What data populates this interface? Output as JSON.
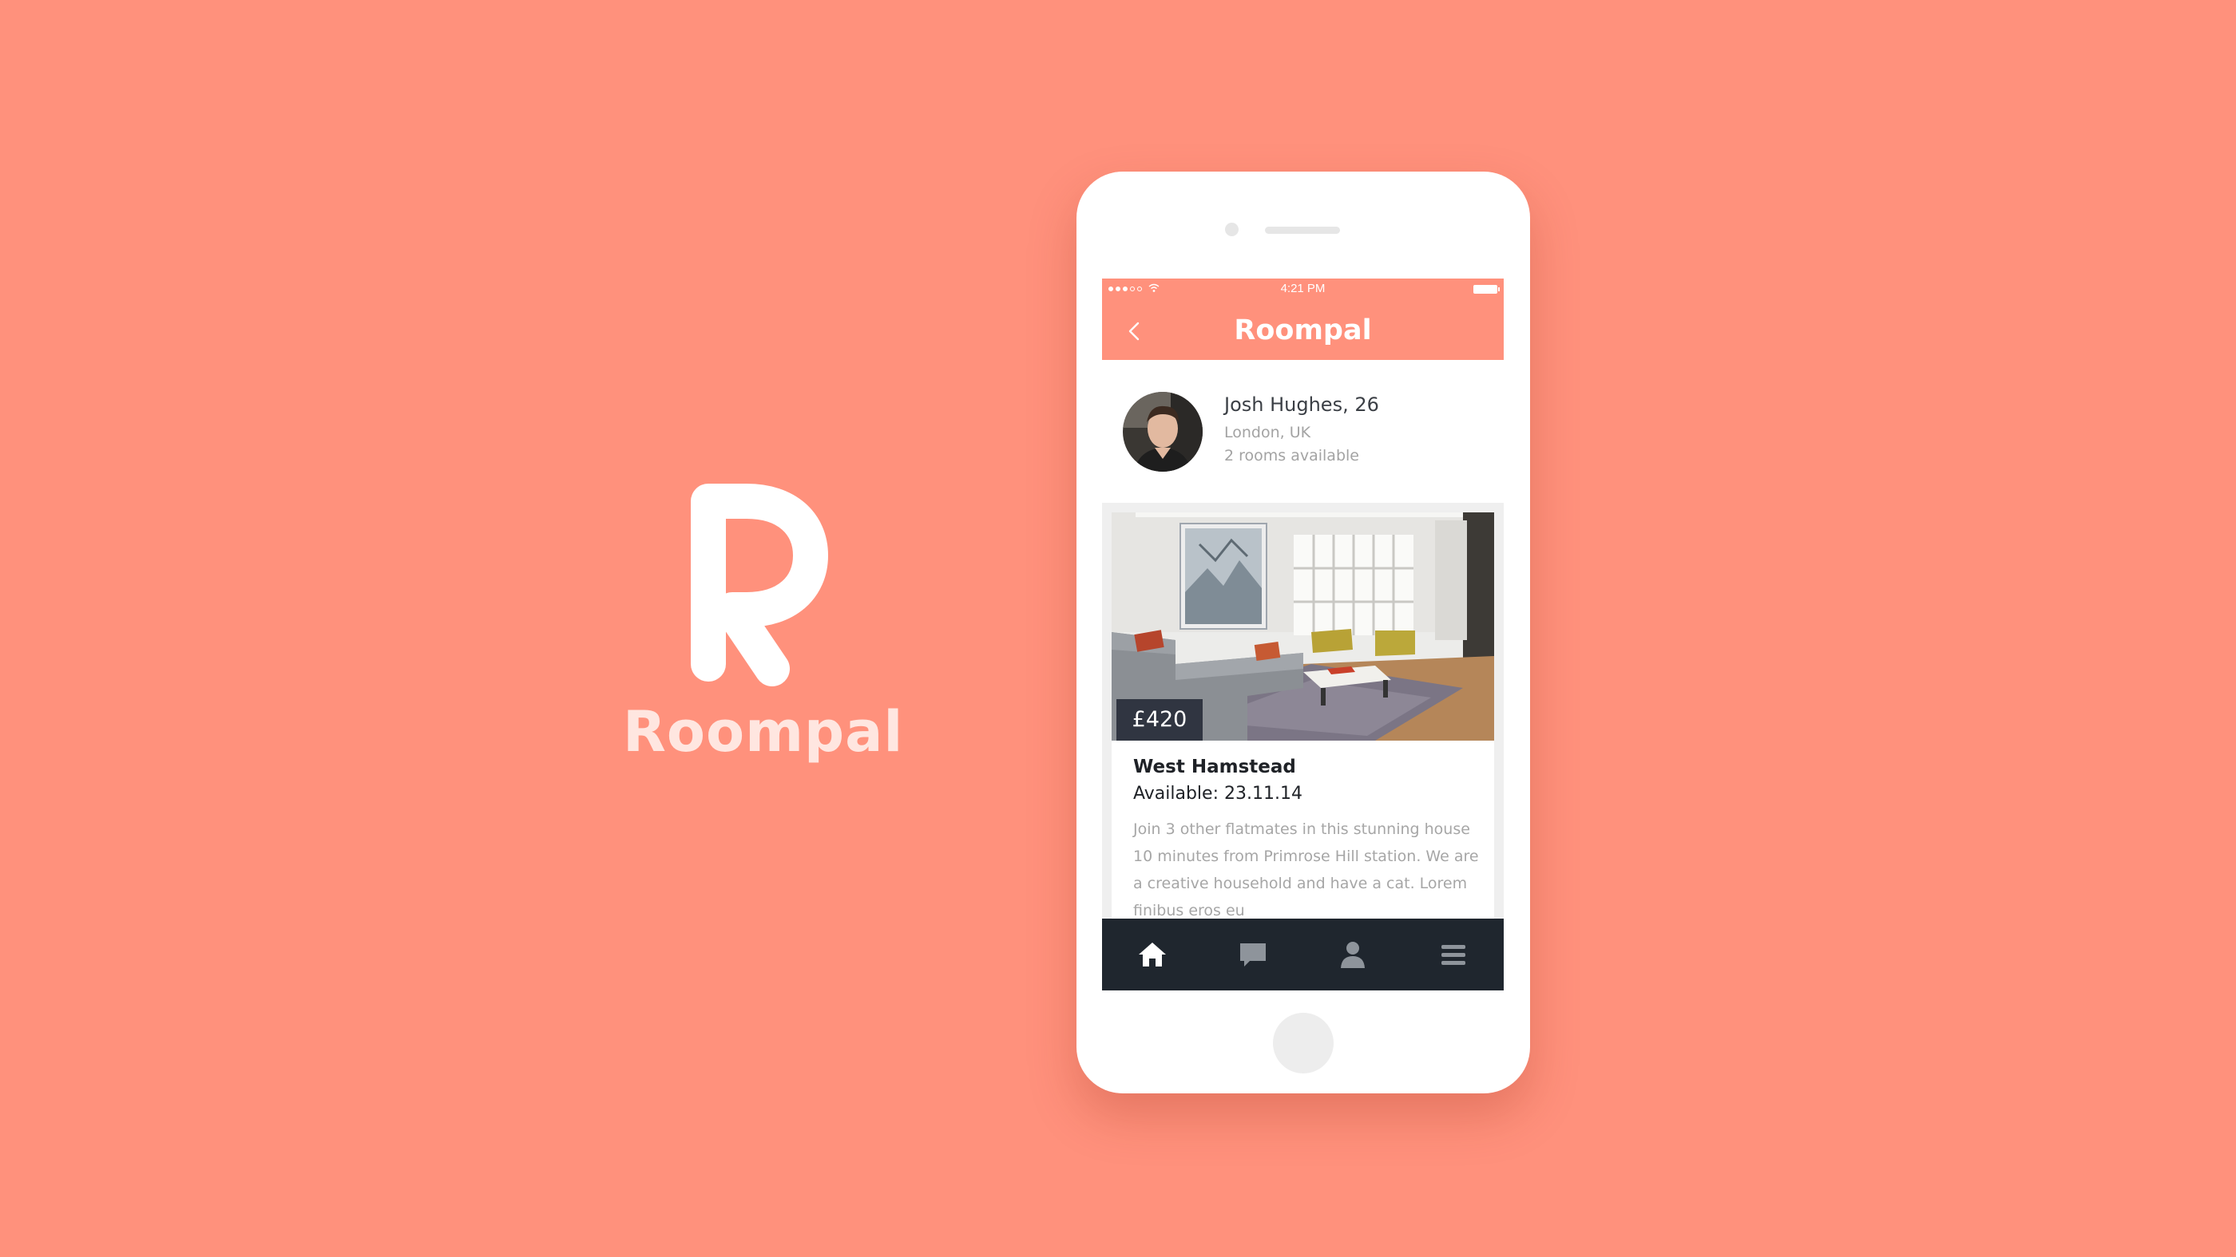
{
  "brand": {
    "name": "Roompal",
    "logo_letter_icon": "roompal-r-logo"
  },
  "status_bar": {
    "signal_dots": 5,
    "signal_strength": 3,
    "wifi_icon": "wifi-icon",
    "time": "4:21 PM",
    "battery_icon": "battery-icon"
  },
  "nav": {
    "back_icon": "chevron-left-icon",
    "title": "Roompal"
  },
  "profile": {
    "name": "Josh Hughes, 26",
    "location": "London, UK",
    "rooms": "2 rooms available",
    "avatar_icon": "avatar"
  },
  "listing": {
    "price": "£420",
    "area": "West Hamstead",
    "available": "Available: 23.11.14",
    "description": "Join 3 other flatmates in this stunning house 10 minutes from Primrose Hill station. We are a creative household and have a cat. Lorem finibus eros eu"
  },
  "tab_bar": {
    "items": [
      {
        "name": "home",
        "icon": "home-icon",
        "active": true
      },
      {
        "name": "messages",
        "icon": "chat-icon",
        "active": false
      },
      {
        "name": "profile",
        "icon": "user-icon",
        "active": false
      },
      {
        "name": "menu",
        "icon": "menu-icon",
        "active": false
      }
    ]
  },
  "colors": {
    "background": "#FF917C",
    "tab_bar": "#1F262E",
    "price_badge": "#282E3A",
    "tab_active": "#FFFFFF",
    "tab_inactive": "#8E949B"
  }
}
